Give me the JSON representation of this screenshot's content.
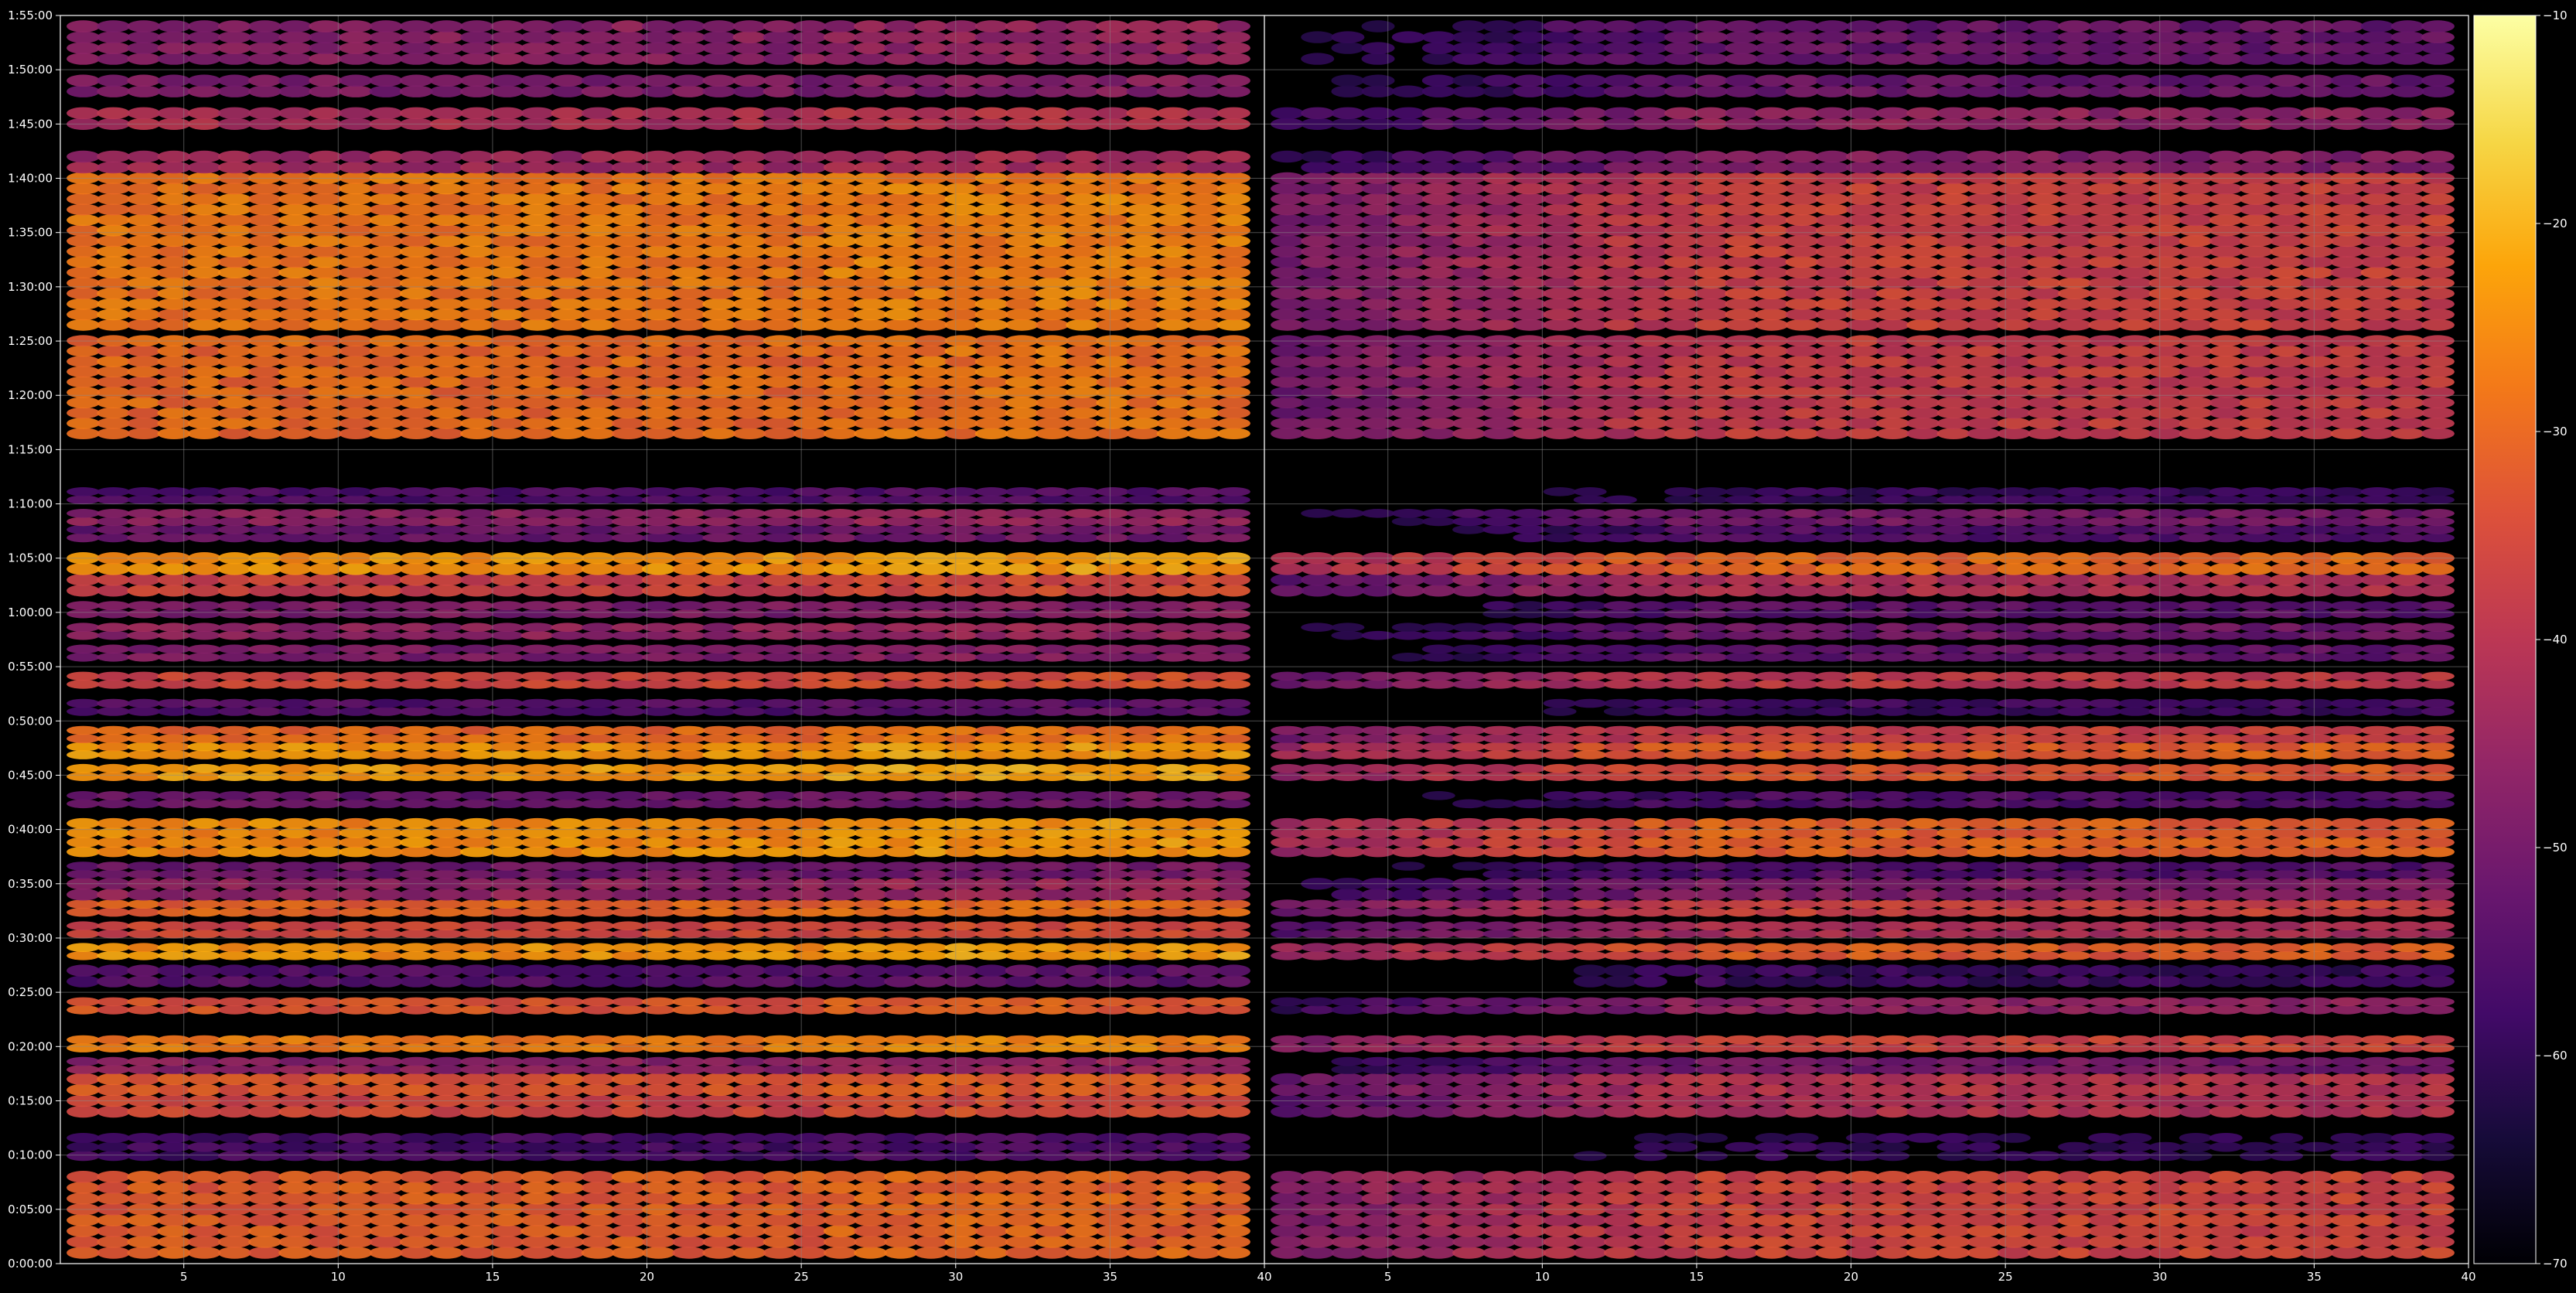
{
  "chart_data": {
    "type": "heatmap",
    "title": "",
    "xlabel": "",
    "ylabel": "",
    "colormap": "inferno",
    "color_range": [
      -70,
      -10
    ],
    "panels": [
      {
        "x_range": [
          1,
          40
        ],
        "x_ticks": [
          5,
          10,
          15,
          20,
          25,
          30,
          35,
          40
        ],
        "x_tick_labels": [
          "5",
          "10",
          "15",
          "20",
          "25",
          "30",
          "35",
          "40"
        ]
      },
      {
        "x_range": [
          1,
          40
        ],
        "x_ticks": [
          5,
          10,
          15,
          20,
          25,
          30,
          35,
          40
        ],
        "x_tick_labels": [
          "5",
          "10",
          "15",
          "20",
          "25",
          "30",
          "35",
          "40"
        ]
      }
    ],
    "y_range_seconds": [
      0,
      6900
    ],
    "y_tick_labels": [
      "0:00:00",
      "0:05:00",
      "0:10:00",
      "0:15:00",
      "0:20:00",
      "0:25:00",
      "0:30:00",
      "0:35:00",
      "0:40:00",
      "0:45:00",
      "0:50:00",
      "0:55:00",
      "1:00:00",
      "1:05:00",
      "1:10:00",
      "1:15:00",
      "1:20:00",
      "1:25:00",
      "1:30:00",
      "1:35:00",
      "1:40:00",
      "1:45:00",
      "1:50:00",
      "1:55:00"
    ],
    "colorbar_ticks": [
      -10,
      -20,
      -30,
      -40,
      -50,
      -60,
      -70
    ],
    "colorbar_tick_labels": [
      "−10",
      "−20",
      "−30",
      "−40",
      "−50",
      "−60",
      "−70"
    ],
    "grid": true,
    "bands": [
      {
        "start_min": 0.5,
        "end_min": 8.5,
        "p1": -32,
        "p2": -36
      },
      {
        "start_min": 9.5,
        "end_min": 12,
        "p1": -57,
        "p2": -60
      },
      {
        "start_min": 13.5,
        "end_min": 15.5,
        "p1": -36,
        "p2": -41
      },
      {
        "start_min": 15.5,
        "end_min": 17.5,
        "p1": -33,
        "p2": -40
      },
      {
        "start_min": 17.5,
        "end_min": 19,
        "p1": -47,
        "p2": -50
      },
      {
        "start_min": 19.5,
        "end_min": 21,
        "p1": -27,
        "p2": -36
      },
      {
        "start_min": 23,
        "end_min": 24.5,
        "p1": -33,
        "p2": -46
      },
      {
        "start_min": 25.5,
        "end_min": 27.5,
        "p1": -55,
        "p2": -59
      },
      {
        "start_min": 28,
        "end_min": 29.5,
        "p1": -24,
        "p2": -32
      },
      {
        "start_min": 30,
        "end_min": 31.5,
        "p1": -36,
        "p2": -42
      },
      {
        "start_min": 32,
        "end_min": 33.5,
        "p1": -31,
        "p2": -37
      },
      {
        "start_min": 33.5,
        "end_min": 35.5,
        "p1": -46,
        "p2": -48
      },
      {
        "start_min": 35.5,
        "end_min": 37,
        "p1": -51,
        "p2": -55
      },
      {
        "start_min": 37.5,
        "end_min": 41,
        "p1": -25,
        "p2": -31
      },
      {
        "start_min": 42,
        "end_min": 43.5,
        "p1": -52,
        "p2": -56
      },
      {
        "start_min": 44.5,
        "end_min": 46,
        "p1": -23,
        "p2": -33
      },
      {
        "start_min": 46.5,
        "end_min": 48,
        "p1": -24,
        "p2": -31
      },
      {
        "start_min": 48,
        "end_min": 49.5,
        "p1": -30,
        "p2": -37
      },
      {
        "start_min": 50.5,
        "end_min": 52,
        "p1": -55,
        "p2": -58
      },
      {
        "start_min": 53,
        "end_min": 54.5,
        "p1": -36,
        "p2": -39
      },
      {
        "start_min": 55.5,
        "end_min": 57,
        "p1": -49,
        "p2": -53
      },
      {
        "start_min": 57.5,
        "end_min": 59,
        "p1": -46,
        "p2": -51
      },
      {
        "start_min": 59.5,
        "end_min": 61,
        "p1": -49,
        "p2": -54
      },
      {
        "start_min": 61.5,
        "end_min": 63.5,
        "p1": -37,
        "p2": -41
      },
      {
        "start_min": 63.5,
        "end_min": 65.5,
        "p1": -24,
        "p2": -30
      },
      {
        "start_min": 66.5,
        "end_min": 68,
        "p1": -52,
        "p2": -55
      },
      {
        "start_min": 68,
        "end_min": 69.5,
        "p1": -47,
        "p2": -50
      },
      {
        "start_min": 70,
        "end_min": 71.5,
        "p1": -56,
        "p2": -59
      },
      {
        "start_min": 76,
        "end_min": 85.5,
        "p1": -30,
        "p2": -38
      },
      {
        "start_min": 86,
        "end_min": 100.5,
        "p1": -28,
        "p2": -37
      },
      {
        "start_min": 100.5,
        "end_min": 102.5,
        "p1": -44,
        "p2": -48
      },
      {
        "start_min": 104.5,
        "end_min": 106.5,
        "p1": -42,
        "p2": -46
      },
      {
        "start_min": 107.5,
        "end_min": 109.5,
        "p1": -49,
        "p2": -52
      },
      {
        "start_min": 110.5,
        "end_min": 114.5,
        "p1": -47,
        "p2": -52
      }
    ]
  }
}
